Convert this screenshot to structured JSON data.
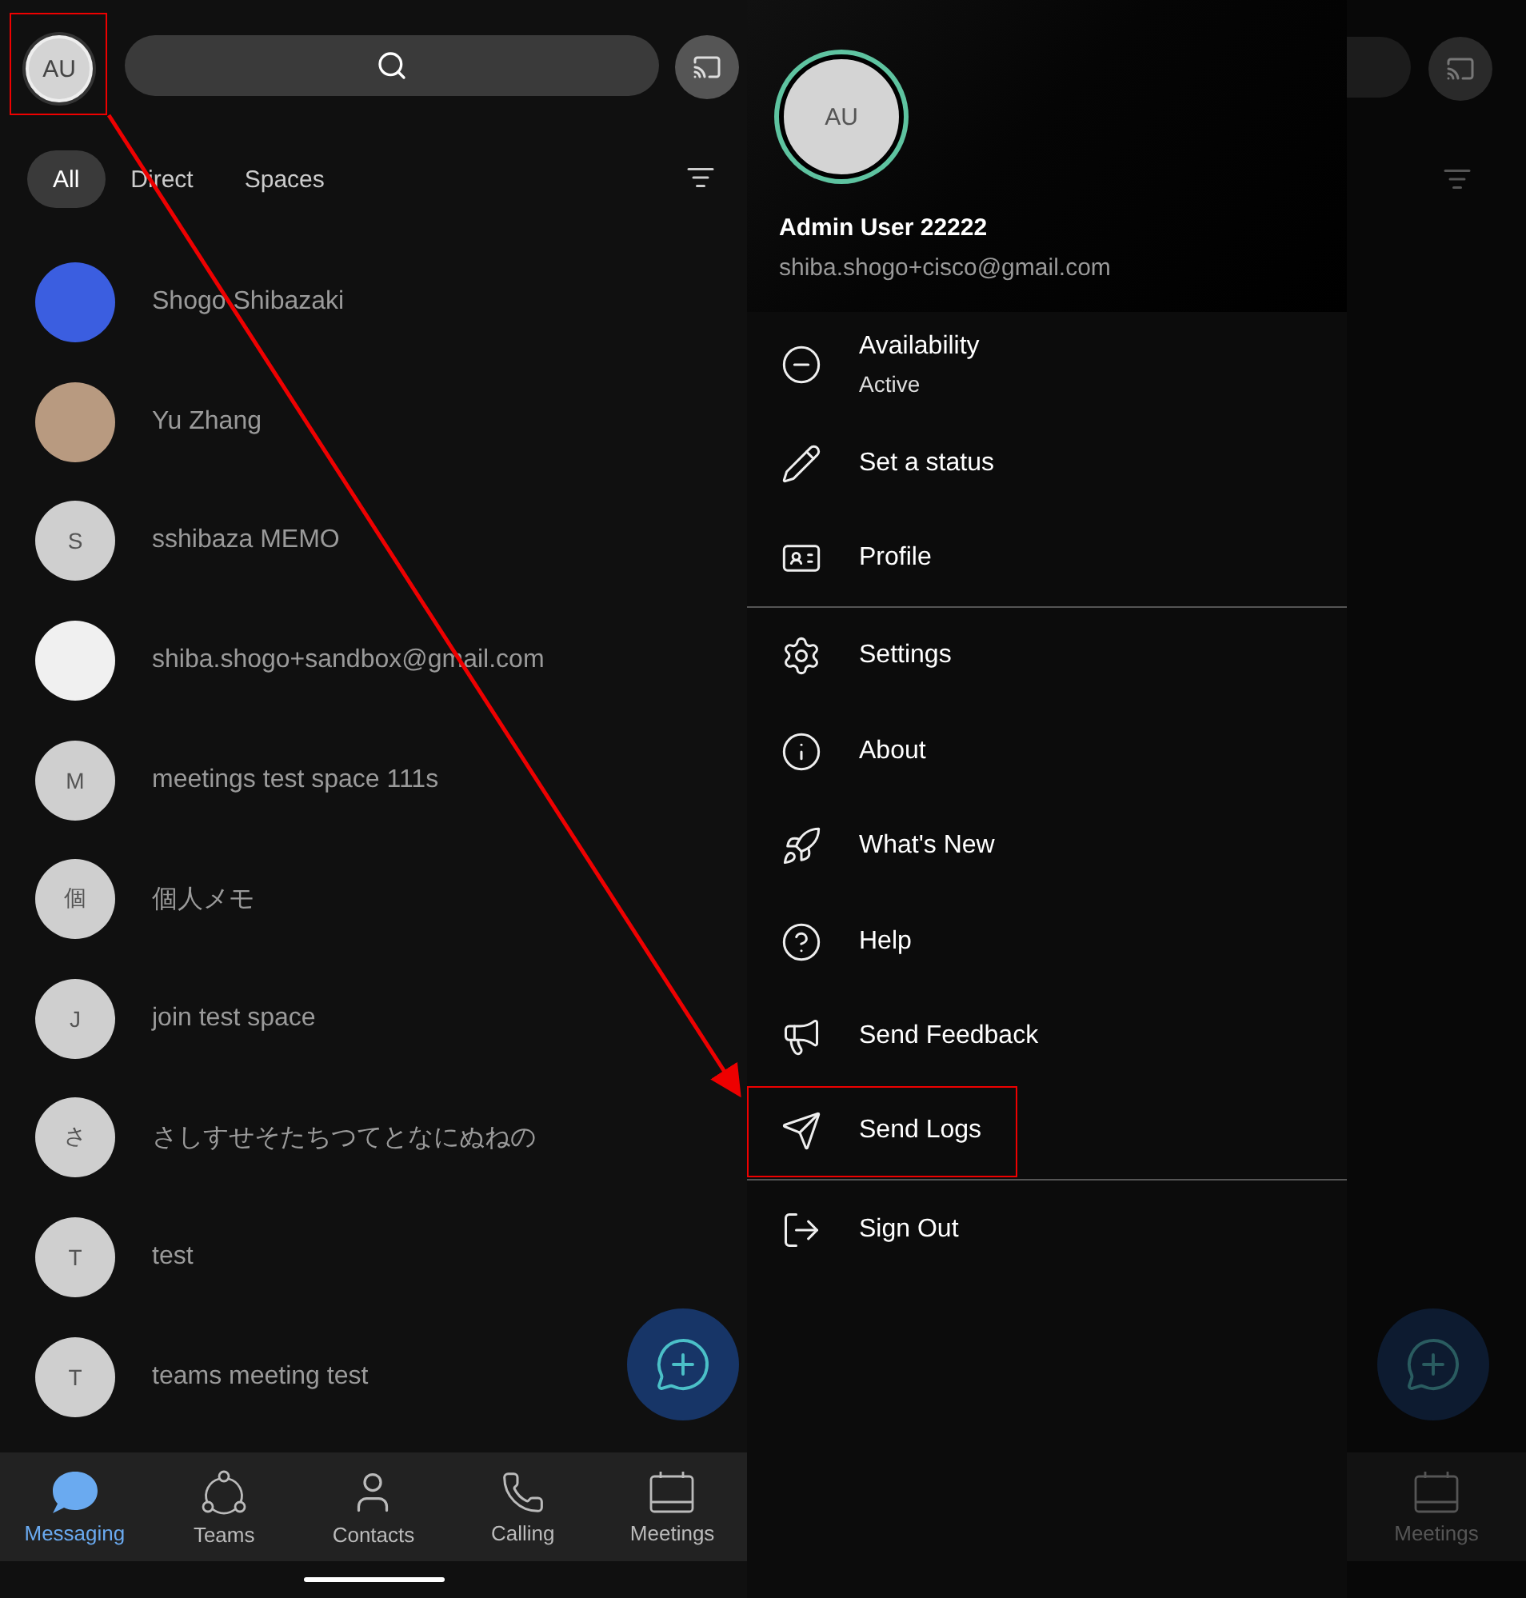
{
  "home": {
    "profile_avatar": {
      "initials": "AU"
    },
    "tabs": [
      {
        "label": "All",
        "selected": true
      },
      {
        "label": "Direct",
        "selected": false
      },
      {
        "label": "Spaces",
        "selected": false
      }
    ],
    "conversations": [
      {
        "kind": "photo",
        "name": "Shogo Shibazaki",
        "color": "#3b5ee0"
      },
      {
        "kind": "photo",
        "name": "Yu Zhang",
        "color": "#b89a80"
      },
      {
        "kind": "initial",
        "initial": "S",
        "name": "sshibaza MEMO"
      },
      {
        "kind": "silhouette",
        "name": "shiba.shogo+sandbox@gmail.com"
      },
      {
        "kind": "initial",
        "initial": "M",
        "name": "meetings test space 111s"
      },
      {
        "kind": "initial",
        "initial": "個",
        "name": "個人メモ"
      },
      {
        "kind": "initial",
        "initial": "J",
        "name": "join test space"
      },
      {
        "kind": "initial",
        "initial": "さ",
        "name": "さしすせそたちつてとなにぬねの"
      },
      {
        "kind": "initial",
        "initial": "T",
        "name": "test"
      },
      {
        "kind": "initial",
        "initial": "T",
        "name": "teams meeting test"
      }
    ],
    "nav": [
      {
        "label": "Messaging",
        "selected": true
      },
      {
        "label": "Teams",
        "selected": false
      },
      {
        "label": "Contacts",
        "selected": false
      },
      {
        "label": "Calling",
        "selected": false
      },
      {
        "label": "Meetings",
        "selected": false
      }
    ]
  },
  "drawer": {
    "avatar": {
      "initials": "AU"
    },
    "name": "Admin User 22222",
    "email": "shiba.shogo+cisco@gmail.com",
    "groups": [
      [
        {
          "label": "Availability",
          "sublabel": "Active"
        },
        {
          "label": "Set a status"
        },
        {
          "label": "Profile"
        }
      ],
      [
        {
          "label": "Settings"
        },
        {
          "label": "About"
        },
        {
          "label": "What's New"
        },
        {
          "label": "Help"
        },
        {
          "label": "Send Feedback"
        },
        {
          "label": "Send Logs",
          "highlighted": true
        }
      ],
      [
        {
          "label": "Sign Out"
        }
      ]
    ],
    "behind_nav": {
      "label": "Meetings"
    }
  }
}
